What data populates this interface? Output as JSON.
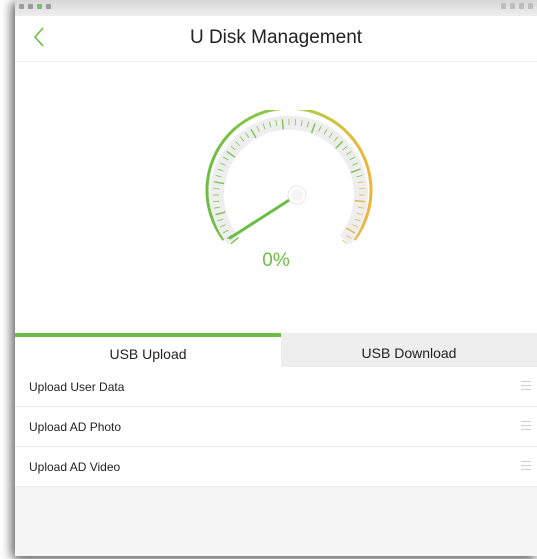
{
  "header": {
    "title": "U Disk Management",
    "back_icon": "chevron-left-icon"
  },
  "progress": {
    "percent_label": "0%",
    "value": 0
  },
  "tabs": [
    {
      "label": "USB Upload",
      "selected": true
    },
    {
      "label": "USB Download",
      "selected": false
    }
  ],
  "items": [
    {
      "label": "Upload User Data",
      "icon": "drag-handle-icon"
    },
    {
      "label": "Upload AD Photo",
      "icon": "drag-handle-icon"
    },
    {
      "label": "Upload AD Video",
      "icon": "drag-handle-icon"
    }
  ],
  "colors": {
    "accent": "#6cbd45",
    "gauge_warning": "#f0b43c"
  }
}
